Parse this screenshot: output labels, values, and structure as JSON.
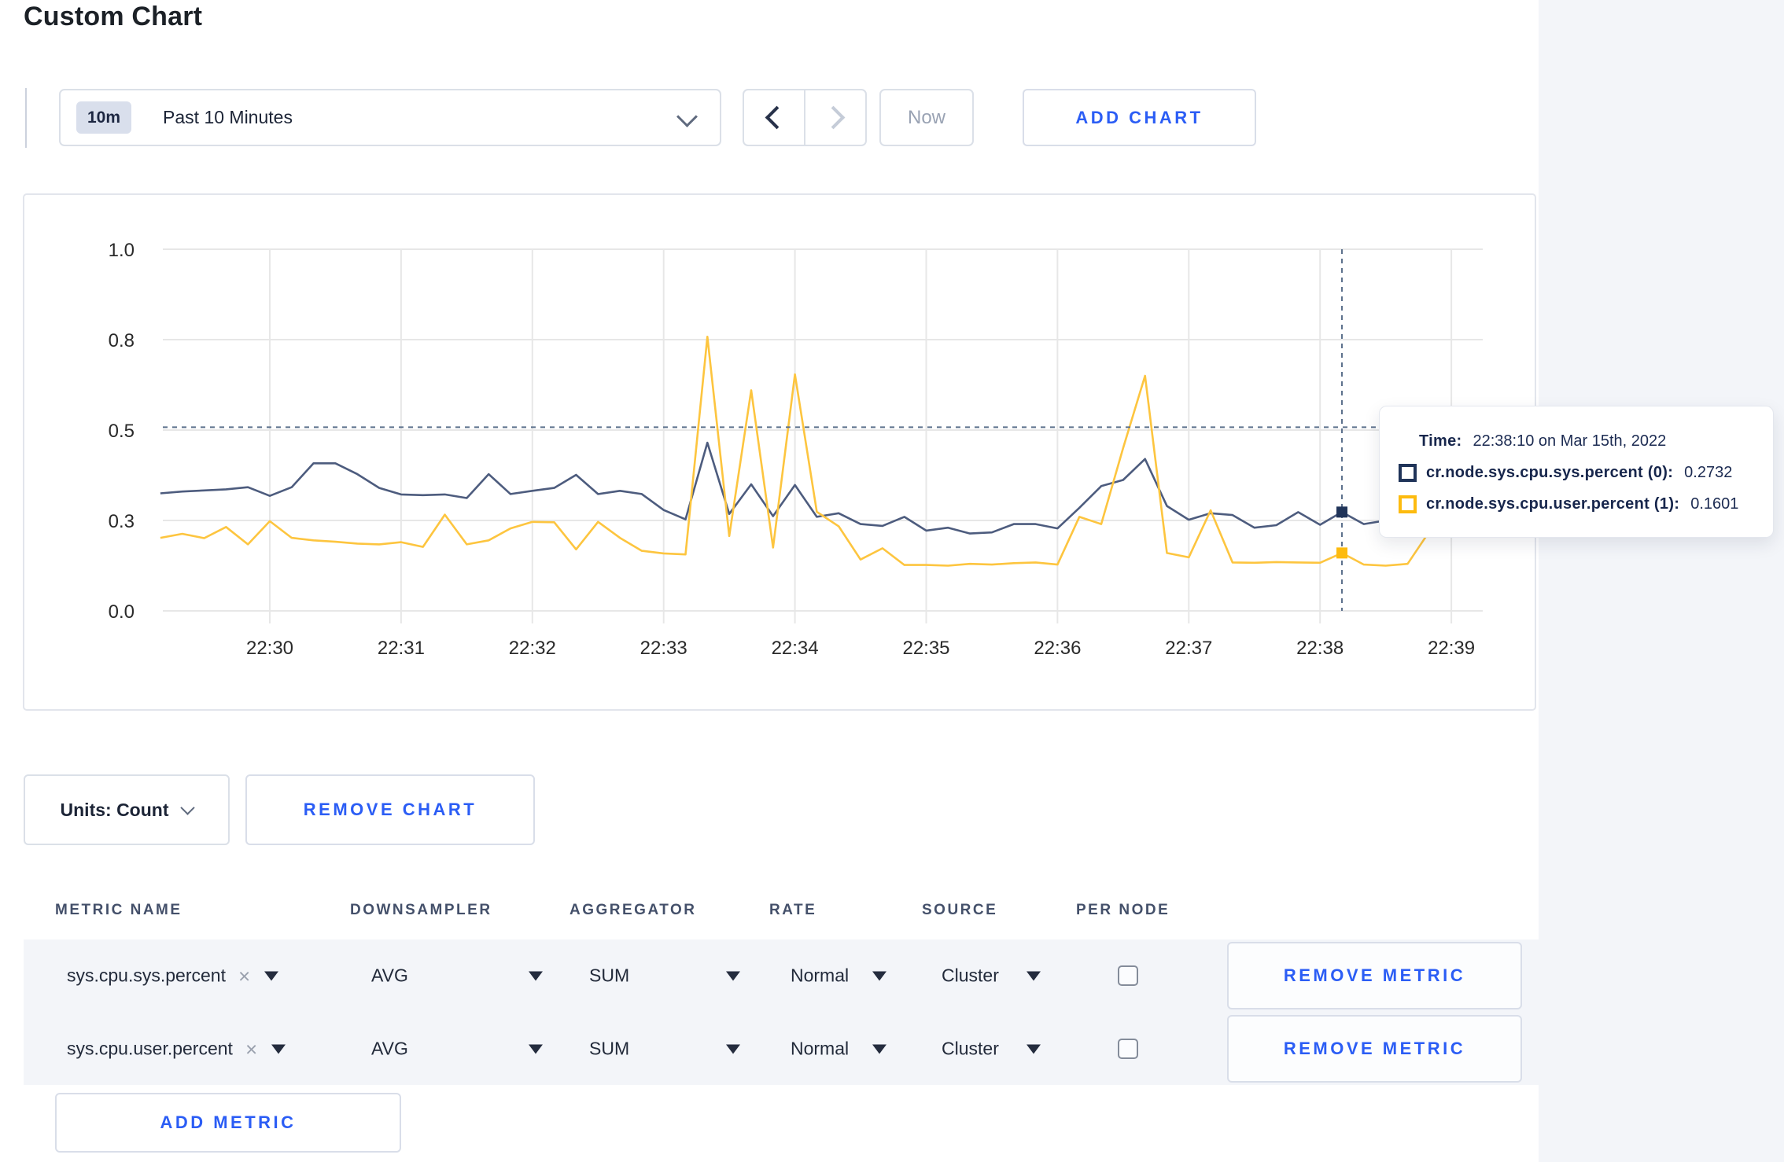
{
  "page": {
    "title": "Custom Chart"
  },
  "toolbar": {
    "range_badge": "10m",
    "range_label": "Past 10 Minutes",
    "prev_icon": "chevron-left",
    "next_icon": "chevron-right",
    "now_label": "Now",
    "add_chart_label": "ADD CHART"
  },
  "tooltip": {
    "time_label": "Time:",
    "time_value": "22:38:10 on Mar 15th, 2022",
    "series": [
      {
        "label": "cr.node.sys.cpu.sys.percent (0):",
        "value": "0.2732",
        "color": "#203459"
      },
      {
        "label": "cr.node.sys.cpu.user.percent (1):",
        "value": "0.1601",
        "color": "#fdbb0f"
      }
    ]
  },
  "chart_data": {
    "type": "line",
    "title": "",
    "xlabel": "",
    "ylabel": "",
    "ylim": [
      0,
      1
    ],
    "grid": true,
    "x_start": "22:29:10",
    "x_interval_seconds": 10,
    "x_tick_labels": [
      "22:30",
      "22:31",
      "22:32",
      "22:33",
      "22:34",
      "22:35",
      "22:36",
      "22:37",
      "22:38",
      "22:39"
    ],
    "y_tick_labels": [
      "0.0",
      "0.3",
      "0.5",
      "0.8",
      "1.0"
    ],
    "y_tick_values": [
      0,
      0.25,
      0.5,
      0.75,
      1.0
    ],
    "series": [
      {
        "name": "cr.node.sys.cpu.sys.percent (0)",
        "color": "#4d5c7e",
        "marker_color": "#203459",
        "values": [
          0.325,
          0.33,
          0.333,
          0.336,
          0.342,
          0.318,
          0.342,
          0.408,
          0.408,
          0.378,
          0.34,
          0.322,
          0.32,
          0.322,
          0.312,
          0.378,
          0.323,
          0.332,
          0.34,
          0.376,
          0.323,
          0.332,
          0.323,
          0.279,
          0.253,
          0.465,
          0.268,
          0.35,
          0.262,
          0.348,
          0.26,
          0.27,
          0.24,
          0.235,
          0.26,
          0.222,
          0.23,
          0.214,
          0.217,
          0.24,
          0.24,
          0.228,
          0.285,
          0.345,
          0.362,
          0.42,
          0.29,
          0.252,
          0.27,
          0.265,
          0.23,
          0.237,
          0.273,
          0.238,
          0.2732,
          0.24,
          0.25,
          0.27,
          0.3,
          0.31,
          0.295
        ]
      },
      {
        "name": "cr.node.sys.cpu.user.percent (1)",
        "color": "#fdc53f",
        "marker_color": "#fdbb0f",
        "values": [
          0.202,
          0.213,
          0.201,
          0.232,
          0.184,
          0.248,
          0.202,
          0.195,
          0.191,
          0.186,
          0.184,
          0.19,
          0.177,
          0.266,
          0.184,
          0.195,
          0.228,
          0.246,
          0.245,
          0.17,
          0.246,
          0.202,
          0.166,
          0.159,
          0.156,
          0.758,
          0.207,
          0.61,
          0.175,
          0.654,
          0.274,
          0.234,
          0.142,
          0.173,
          0.127,
          0.127,
          0.125,
          0.13,
          0.128,
          0.132,
          0.134,
          0.128,
          0.26,
          0.24,
          0.45,
          0.65,
          0.16,
          0.148,
          0.278,
          0.134,
          0.133,
          0.135,
          0.134,
          0.133,
          0.1601,
          0.128,
          0.125,
          0.13,
          0.22,
          0.285,
          0.235
        ]
      }
    ],
    "crosshair": {
      "hover_time": "22:38:10",
      "index": 54,
      "y_value": 0.508
    },
    "legend_position": "tooltip-only"
  },
  "units_row": {
    "units_label": "Units: Count",
    "remove_chart_label": "REMOVE CHART"
  },
  "metrics_table": {
    "headers": [
      "METRIC NAME",
      "DOWNSAMPLER",
      "AGGREGATOR",
      "RATE",
      "SOURCE",
      "PER NODE"
    ],
    "rows": [
      {
        "metric": "sys.cpu.sys.percent",
        "remove_tag": "×",
        "downsampler": "AVG",
        "aggregator": "SUM",
        "rate": "Normal",
        "source": "Cluster",
        "per_node_checked": false,
        "remove_label": "REMOVE METRIC"
      },
      {
        "metric": "sys.cpu.user.percent",
        "remove_tag": "×",
        "downsampler": "AVG",
        "aggregator": "SUM",
        "rate": "Normal",
        "source": "Cluster",
        "per_node_checked": false,
        "remove_label": "REMOVE METRIC"
      }
    ],
    "add_metric_label": "ADD METRIC"
  },
  "colors": {
    "accent_blue": "#2b5df5",
    "page_bg": "#f3f5f9",
    "gridline": "#e7e7e7",
    "crosshair": "#5c718c",
    "axis_text": "#2a2a2a"
  }
}
